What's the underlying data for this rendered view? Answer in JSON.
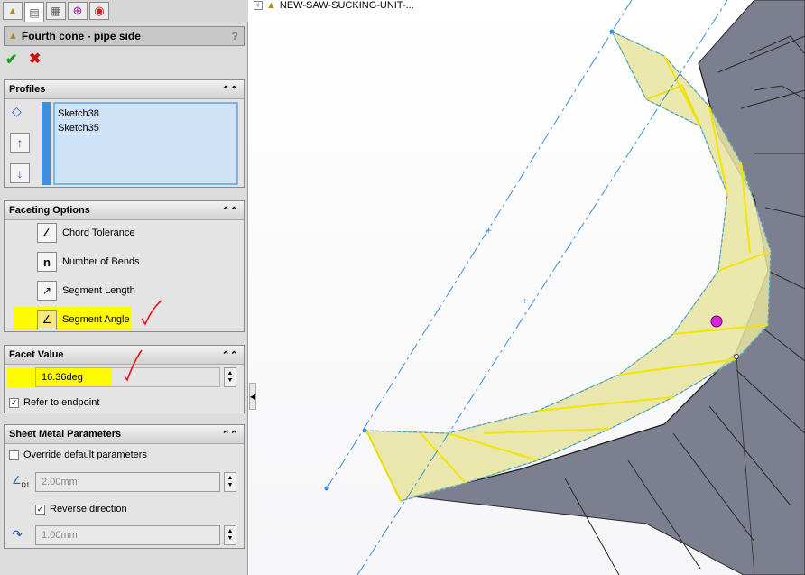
{
  "tree": {
    "label": "NEW-SAW-SUCKING-UNIT-..."
  },
  "feature": {
    "title": "Fourth cone - pipe side",
    "help": "?"
  },
  "profiles": {
    "title": "Profiles",
    "items": [
      "Sketch38",
      "Sketch35"
    ]
  },
  "faceting": {
    "title": "Faceting Options",
    "options": [
      "Chord Tolerance",
      "Number of Bends",
      "Segment Length",
      "Segment Angle"
    ],
    "selected": "Segment Angle"
  },
  "facet_value": {
    "title": "Facet Value",
    "value": "16.36deg",
    "refer_label": "Refer to endpoint",
    "refer_checked": true
  },
  "sheet_metal": {
    "title": "Sheet Metal Parameters",
    "override_label": "Override default parameters",
    "thickness": "2.00mm",
    "reverse_label": "Reverse direction",
    "radius": "1.00mm"
  },
  "colors": {
    "highlight": "#fffb00",
    "annotation": "#e8161b",
    "accent": "#3f8fe0",
    "sheet_fill": "#e9e6a3"
  },
  "icons": [
    "sheet-metal-icon",
    "property-manager-icon",
    "configuration-icon",
    "dimxpert-icon",
    "display-manager-icon"
  ]
}
